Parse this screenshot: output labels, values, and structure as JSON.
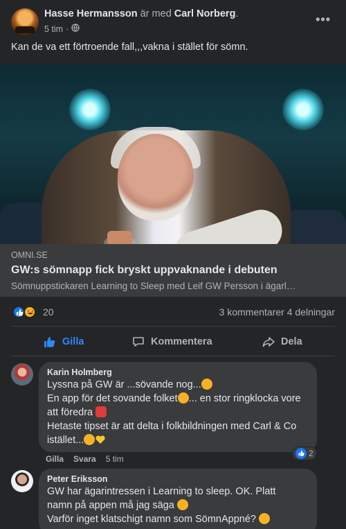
{
  "post": {
    "author": "Hasse Hermansson",
    "with_text": "är med",
    "tagged": "Carl Norberg",
    "tagged_suffix": ".",
    "time": "5 tim",
    "time_sep": "·",
    "more": "•••",
    "text": "Kan de va ett förtroende fall,,,vakna i stället för sömn."
  },
  "link": {
    "domain": "OMNI.SE",
    "title": "GW:s sömnapp fick bryskt uppvaknande i debuten",
    "description": "Sömnuppstickaren Learning to Sleep med Leif GW Persson i ägarl…"
  },
  "stats": {
    "reaction_count": "20",
    "comments": "3 kommentarer",
    "shares": "4 delningar"
  },
  "actions": {
    "like": "Gilla",
    "comment": "Kommentera",
    "share": "Dela"
  },
  "comments": [
    {
      "name": "Karin Holmberg",
      "lines": [
        "Lyssna på GW är ...sövande nog...",
        "En app för det sovande folket",
        "... en stor ringklocka vore",
        "att föredra",
        "Hetaste tipset är att delta i folkbildningen med Carl & Co",
        "istället..."
      ],
      "like": "Gilla",
      "reply": "Svara",
      "time": "5 tim",
      "reaction_count": "2"
    },
    {
      "name": "Peter Eriksson",
      "lines": [
        "GW har ägarintressen i Learning to sleep. OK. Platt",
        "namn på appen må jag säga",
        "Varför inget klatschigt namn som SömnAppné?"
      ]
    }
  ],
  "colors": {
    "background": "#242526",
    "bubble": "#3a3b3c",
    "accent": "#2d88ff",
    "text": "#e4e6eb",
    "muted": "#b0b3b8"
  }
}
